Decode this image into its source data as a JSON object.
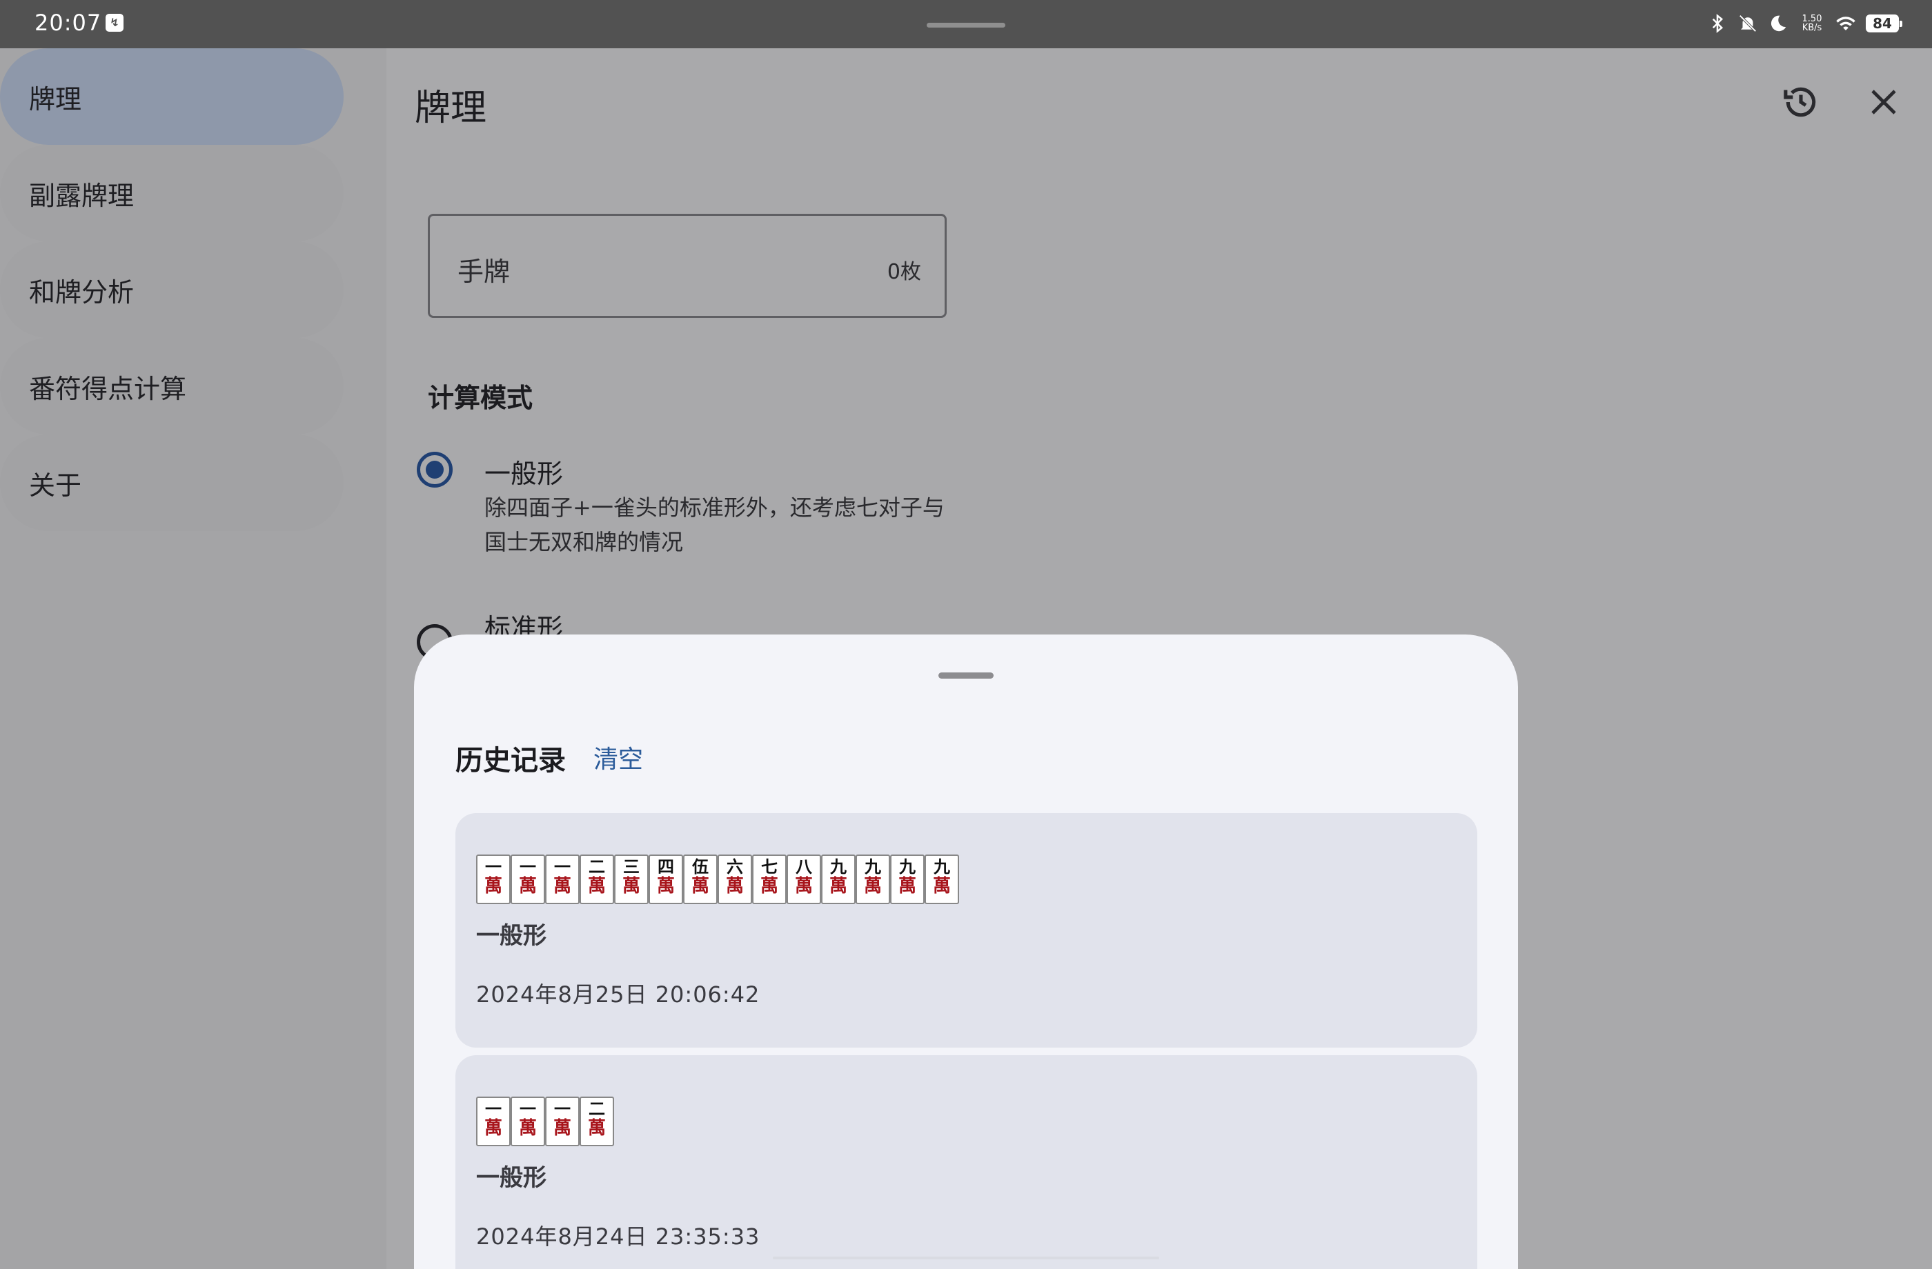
{
  "status_bar": {
    "time": "20:07",
    "net_speed_value": "1.50",
    "net_speed_unit": "KB/s",
    "battery": "84"
  },
  "nav": {
    "items": [
      {
        "label": "牌理",
        "active": true
      },
      {
        "label": "副露牌理",
        "active": false
      },
      {
        "label": "和牌分析",
        "active": false
      },
      {
        "label": "番符得点计算",
        "active": false
      },
      {
        "label": "关于",
        "active": false
      }
    ]
  },
  "main": {
    "title": "牌理",
    "hand_field": {
      "label": "手牌",
      "count": "0枚"
    },
    "mode_section_title": "计算模式",
    "options": [
      {
        "title": "一般形",
        "description": "除四面子+一雀头的标准形外，还考虑七对子与国士无双和牌的情况",
        "selected": true
      },
      {
        "title": "标准形",
        "selected": false
      }
    ]
  },
  "history_sheet": {
    "title": "历史记录",
    "clear_label": "清空",
    "records": [
      {
        "tiles": [
          {
            "num": "一",
            "suit": "萬"
          },
          {
            "num": "一",
            "suit": "萬"
          },
          {
            "num": "一",
            "suit": "萬"
          },
          {
            "num": "二",
            "suit": "萬"
          },
          {
            "num": "三",
            "suit": "萬"
          },
          {
            "num": "四",
            "suit": "萬"
          },
          {
            "num": "伍",
            "suit": "萬"
          },
          {
            "num": "六",
            "suit": "萬"
          },
          {
            "num": "七",
            "suit": "萬"
          },
          {
            "num": "八",
            "suit": "萬"
          },
          {
            "num": "九",
            "suit": "萬"
          },
          {
            "num": "九",
            "suit": "萬"
          },
          {
            "num": "九",
            "suit": "萬"
          },
          {
            "num": "九",
            "suit": "萬"
          }
        ],
        "mode": "一般形",
        "time": "2024年8月25日 20:06:42"
      },
      {
        "tiles": [
          {
            "num": "一",
            "suit": "萬"
          },
          {
            "num": "一",
            "suit": "萬"
          },
          {
            "num": "一",
            "suit": "萬"
          },
          {
            "num": "二",
            "suit": "萬"
          }
        ],
        "mode": "一般形",
        "time": "2024年8月24日 23:35:33"
      }
    ]
  },
  "icons": {
    "history": "history-icon",
    "close": "close-icon"
  },
  "colors": {
    "accent": "#1f3f73",
    "link": "#2b5b9a",
    "active_nav": "#8e98aa",
    "sheet_bg": "#f3f4f9",
    "card_bg": "#e1e3ec",
    "wan_red": "#a8151c"
  }
}
